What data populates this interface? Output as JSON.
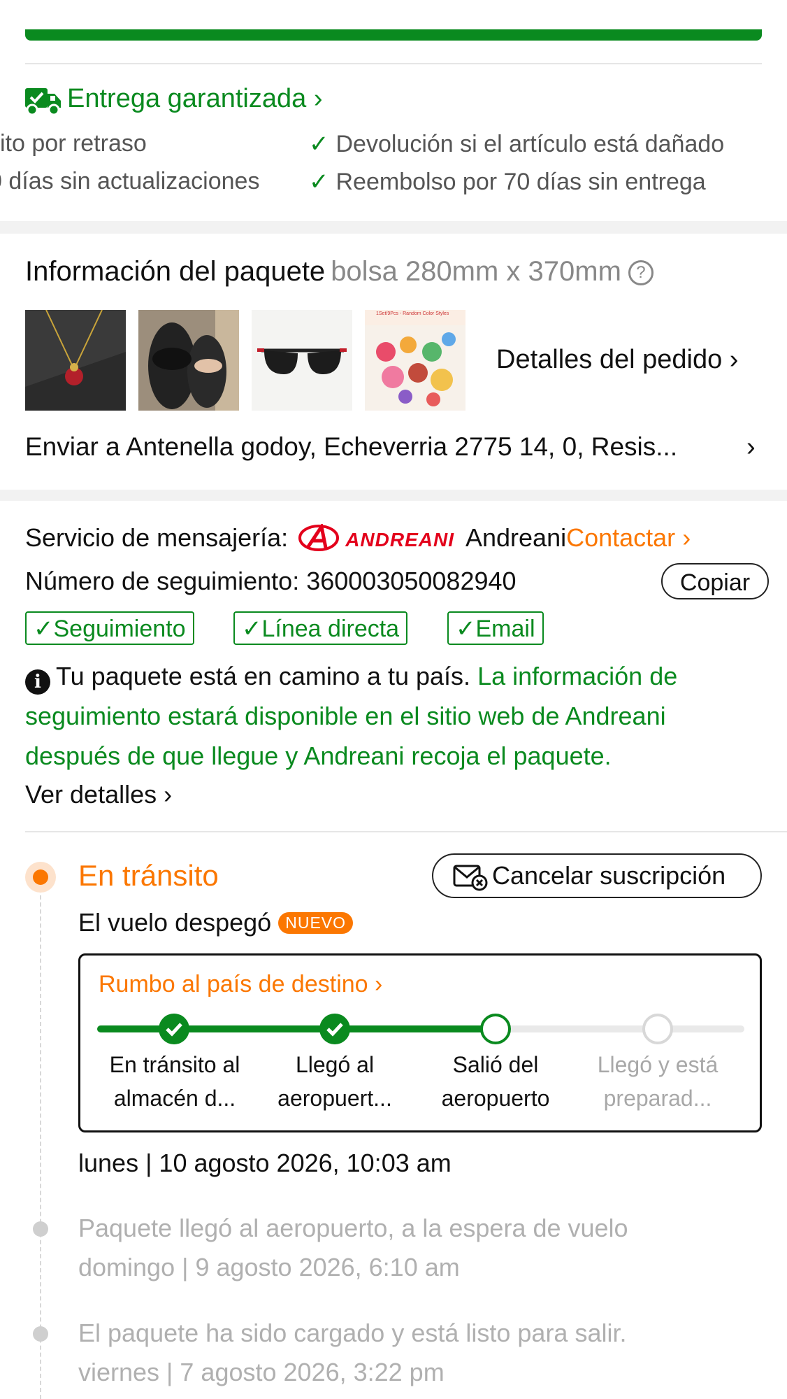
{
  "guarantee": {
    "title": "Entrega garantizada",
    "items_left": [
      "ito por retraso",
      "0 días sin actualizaciones"
    ],
    "items_right": [
      "Devolución si el artículo está dañado",
      "Reembolso por 70 días sin entrega"
    ],
    "accent": "#0a8a1f"
  },
  "package": {
    "title": "Información del paquete",
    "subtitle": "bolsa 280mm x 370mm",
    "order_details_label": "Detalles del pedido",
    "ship_to_label": "Enviar a",
    "ship_to_value": "Antenella godoy, Echeverria 2775 14, 0, Resis...",
    "thumbnails": [
      "necklace-thumbnail",
      "slippers-thumbnail",
      "sunglasses-thumbnail",
      "toy-set-thumbnail"
    ],
    "thumb_caption": "1Set/9Pcs - Random Color Styles"
  },
  "courier": {
    "service_label": "Servicio de mensajería:",
    "logo_text": "ANDREANI",
    "name": "Andreani",
    "contact_label": "Contactar",
    "tracking_label": "Número de seguimiento:",
    "tracking_number": "360003050082940",
    "copy_label": "Copiar",
    "tags": [
      "Seguimiento",
      "Línea directa",
      "Email"
    ],
    "notice_black": "Tu paquete está en camino a tu país.",
    "notice_green": "La información de seguimiento estará disponible en el sitio web de Andreani después de que llegue y Andreani recoja el paquete.",
    "view_details_label": "Ver detalles"
  },
  "timeline": {
    "status_title": "En tránsito",
    "unsubscribe_label": "Cancelar suscripción",
    "latest_event": "El vuelo despegó",
    "new_badge": "NUEVO",
    "route_title": "Rumbo al país de destino",
    "steps": [
      {
        "line1": "En tránsito al",
        "line2": "almacén d...",
        "state": "done"
      },
      {
        "line1": "Llegó al",
        "line2": "aeropuert...",
        "state": "done"
      },
      {
        "line1": "Salió del",
        "line2": "aeropuerto",
        "state": "current"
      },
      {
        "line1": "Llegó y está",
        "line2": "preparad...",
        "state": "pending"
      }
    ],
    "latest_time": "lunes | 10 agosto 2026, 10:03 am",
    "events": [
      {
        "text": "Paquete llegó al aeropuerto, a la espera de vuelo",
        "time": "domingo | 9 agosto 2026, 6:10 am"
      },
      {
        "text": "El paquete ha sido cargado y está listo para salir.",
        "time": "viernes | 7 agosto 2026, 3:22 pm"
      }
    ]
  },
  "colors": {
    "green": "#0a8a1f",
    "orange": "#fb7701",
    "andreani_red": "#e3001b"
  }
}
